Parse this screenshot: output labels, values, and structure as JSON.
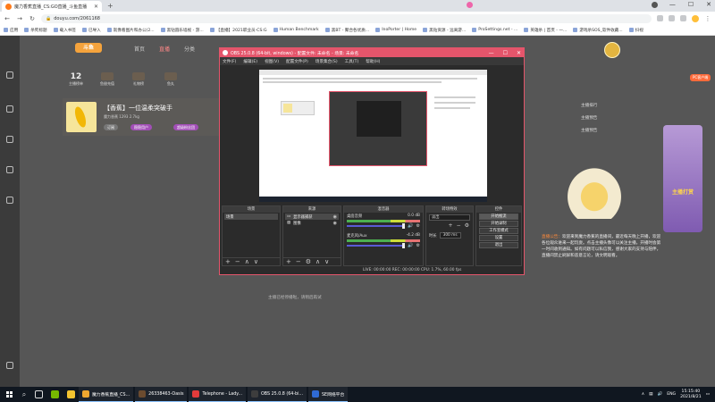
{
  "browser": {
    "tab_title": "魔力香蕉直播_CS:GO直播_斗鱼直播",
    "url": "douyu.com/2061168",
    "bookmarks": [
      "应用",
      "杀死标题",
      "载入书签",
      "已导入",
      "就像看图片和办公(2...",
      "黑钻圆乐墙视 - 游...",
      "【直播】2021职业员-CS:G",
      "Human Benchmark",
      "黑BT - 聚合各优质...",
      "InoPorter | Home",
      "黑钻资源 - 远离游...",
      "ProSettings.net - ...",
      "英雄杀 | 首页 - 一...",
      "游戏杀SOS_软件收藏...",
      "抖视"
    ]
  },
  "douyu": {
    "logo": "斗鱼",
    "nav": [
      "首页",
      "直播",
      "分类"
    ],
    "stats": [
      {
        "value": "12",
        "label": "主播榜单"
      },
      {
        "label": "鱼翅充值"
      },
      {
        "label": "礼物榜"
      },
      {
        "label": "鱼丸"
      }
    ],
    "stream_title": "【香蕉】一位温柔突破手",
    "stream_sub": "魔力香蕉  1293  2.7kg",
    "pills": [
      "订阅",
      "稳稳用户",
      "超级粉丝团"
    ],
    "center_note": "主播已经停播啦，请稍后再试",
    "rank_rows": [
      "主播排行",
      "主播预告",
      "主播预告"
    ],
    "right_btns": [
      "PC客户端"
    ],
    "bonus_text": "主播打赏",
    "announce_head": "直播公告：",
    "announce_body": "欢迎来到魔力香蕉的直播间，最近每天晚上开播，欢迎各位观众进来一起玩耍。点击主播头像可以关注主播，开播时会第一时间收到通知。如有问题可以私信我，感谢大家的支持与陪伴，直播间禁止刷屏和恶意言论，请文明观看。"
  },
  "obs": {
    "title": "OBS 25.0.8 (64-bit, windows) - 配置文件: 未命名 - 场景: 未命名",
    "menu": [
      "文件(F)",
      "编辑(E)",
      "视图(V)",
      "配置文件(P)",
      "场景集合(S)",
      "工具(T)",
      "帮助(H)"
    ],
    "docks": {
      "scenes": {
        "header": "场景",
        "items": [
          "场景"
        ]
      },
      "sources": {
        "header": "来源",
        "items": [
          "显示器捕获",
          "图像"
        ]
      },
      "mixer": {
        "header": "混音器",
        "tracks": [
          {
            "name": "桌面音频",
            "level": "0.0 dB"
          },
          {
            "name": "麦克风/Aux",
            "level": "-4.2 dB"
          }
        ]
      },
      "transitions": {
        "header": "转场特效",
        "type": "淡出",
        "duration_label": "时长",
        "duration": "300 ms"
      },
      "controls": {
        "header": "控件",
        "buttons": [
          "开始推流",
          "开始录制",
          "工作室模式",
          "设置",
          "退出"
        ]
      }
    },
    "status": "LIVE: 00:00:00   REC: 00:00:00   CPU: 1.7%, 60.00 fps"
  },
  "taskbar": {
    "tasks": [
      {
        "label": "魔力香蕉直播_CS...",
        "color": "#f0a830"
      },
      {
        "label": "26338463-Oasis",
        "color": "#6b4b2f"
      },
      {
        "label": "Telephone - Lady...",
        "color": "#e33b3b"
      },
      {
        "label": "OBS 25.0.8 (64-bi...",
        "color": "#3d3d3d"
      },
      {
        "label": "SE网络平台",
        "color": "#2f6ad4"
      }
    ],
    "tray_lang": "ENG",
    "time": "15:15:40",
    "date": "2021/8/21"
  }
}
